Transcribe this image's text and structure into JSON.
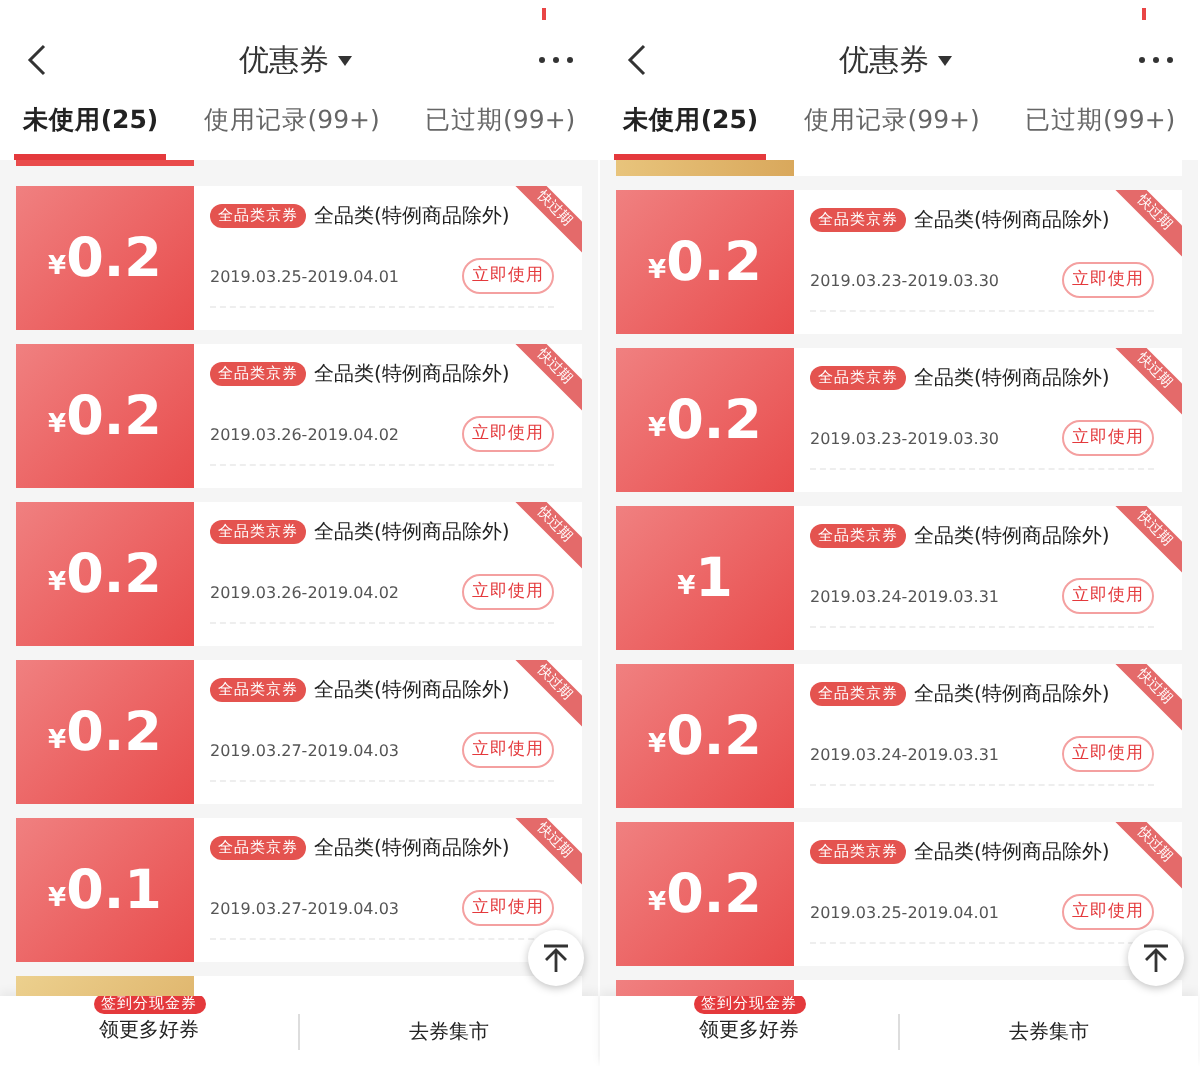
{
  "panels": [
    {
      "title": "优惠券",
      "tabs": [
        {
          "label": "未使用(25)",
          "selected": true
        },
        {
          "label": "使用记录(99+)",
          "selected": false
        },
        {
          "label": "已过期(99+)",
          "selected": false
        }
      ],
      "coupons": [
        {
          "kind": "red_stub"
        },
        {
          "kind": "coupon",
          "currency": "¥",
          "amount": "0.2",
          "badge": "全品类京券",
          "title": "全品类(特例商品除外)",
          "dates": "2019.03.25-2019.04.01",
          "button": "立即使用",
          "ribbon": "快过期"
        },
        {
          "kind": "coupon",
          "currency": "¥",
          "amount": "0.2",
          "badge": "全品类京券",
          "title": "全品类(特例商品除外)",
          "dates": "2019.03.26-2019.04.02",
          "button": "立即使用",
          "ribbon": "快过期"
        },
        {
          "kind": "coupon",
          "currency": "¥",
          "amount": "0.2",
          "badge": "全品类京券",
          "title": "全品类(特例商品除外)",
          "dates": "2019.03.26-2019.04.02",
          "button": "立即使用",
          "ribbon": "快过期"
        },
        {
          "kind": "coupon",
          "currency": "¥",
          "amount": "0.2",
          "badge": "全品类京券",
          "title": "全品类(特例商品除外)",
          "dates": "2019.03.27-2019.04.03",
          "button": "立即使用",
          "ribbon": "快过期"
        },
        {
          "kind": "coupon",
          "currency": "¥",
          "amount": "0.1",
          "badge": "全品类京券",
          "title": "全品类(特例商品除外)",
          "dates": "2019.03.27-2019.04.03",
          "button": "立即使用",
          "ribbon": "快过期"
        },
        {
          "kind": "gold_partial"
        }
      ],
      "bottom_bar": {
        "items": [
          {
            "label": "领更多好券",
            "badge": "签到分现金券"
          },
          {
            "label": "去券集市"
          }
        ]
      }
    },
    {
      "title": "优惠券",
      "tabs": [
        {
          "label": "未使用(25)",
          "selected": true
        },
        {
          "label": "使用记录(99+)",
          "selected": false
        },
        {
          "label": "已过期(99+)",
          "selected": false
        }
      ],
      "coupons": [
        {
          "kind": "gold_stub"
        },
        {
          "kind": "coupon",
          "currency": "¥",
          "amount": "0.2",
          "badge": "全品类京券",
          "title": "全品类(特例商品除外)",
          "dates": "2019.03.23-2019.03.30",
          "button": "立即使用",
          "ribbon": "快过期"
        },
        {
          "kind": "coupon",
          "currency": "¥",
          "amount": "0.2",
          "badge": "全品类京券",
          "title": "全品类(特例商品除外)",
          "dates": "2019.03.23-2019.03.30",
          "button": "立即使用",
          "ribbon": "快过期"
        },
        {
          "kind": "coupon",
          "currency": "¥",
          "amount": "1",
          "badge": "全品类京券",
          "title": "全品类(特例商品除外)",
          "dates": "2019.03.24-2019.03.31",
          "button": "立即使用",
          "ribbon": "快过期"
        },
        {
          "kind": "coupon",
          "currency": "¥",
          "amount": "0.2",
          "badge": "全品类京券",
          "title": "全品类(特例商品除外)",
          "dates": "2019.03.24-2019.03.31",
          "button": "立即使用",
          "ribbon": "快过期"
        },
        {
          "kind": "coupon",
          "currency": "¥",
          "amount": "0.2",
          "badge": "全品类京券",
          "title": "全品类(特例商品除外)",
          "dates": "2019.03.25-2019.04.01",
          "button": "立即使用",
          "ribbon": "快过期"
        },
        {
          "kind": "red_partial"
        }
      ],
      "bottom_bar": {
        "items": [
          {
            "label": "领更多好券",
            "badge": "签到分现金券"
          },
          {
            "label": "去券集市"
          }
        ]
      }
    }
  ]
}
